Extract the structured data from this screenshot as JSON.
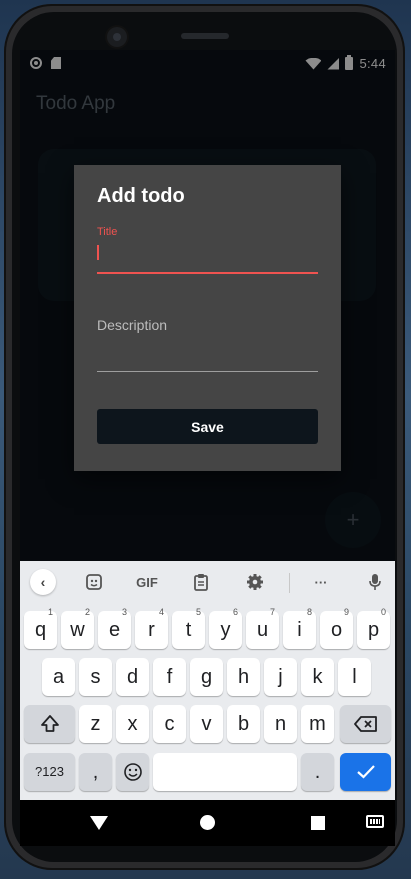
{
  "status_bar": {
    "time": "5:44"
  },
  "app": {
    "title": "Todo App",
    "fab_label": "+"
  },
  "dialog": {
    "title": "Add todo",
    "title_field_label": "Title",
    "title_field_value": "",
    "description_field_label": "Description",
    "description_field_value": "",
    "save_label": "Save"
  },
  "keyboard": {
    "toolbar": {
      "back": "‹",
      "gif": "GIF",
      "more": "···"
    },
    "row1": [
      {
        "key": "q",
        "hint": "1"
      },
      {
        "key": "w",
        "hint": "2"
      },
      {
        "key": "e",
        "hint": "3"
      },
      {
        "key": "r",
        "hint": "4"
      },
      {
        "key": "t",
        "hint": "5"
      },
      {
        "key": "y",
        "hint": "6"
      },
      {
        "key": "u",
        "hint": "7"
      },
      {
        "key": "i",
        "hint": "8"
      },
      {
        "key": "o",
        "hint": "9"
      },
      {
        "key": "p",
        "hint": "0"
      }
    ],
    "row2": [
      "a",
      "s",
      "d",
      "f",
      "g",
      "h",
      "j",
      "k",
      "l"
    ],
    "row3": [
      "z",
      "x",
      "c",
      "v",
      "b",
      "n",
      "m"
    ],
    "row4": {
      "symbols": "?123",
      "comma": ",",
      "period": "."
    },
    "icons": [
      "emoji-sticker-icon",
      "clipboard-icon",
      "settings-icon",
      "mic-icon",
      "shift-icon",
      "backspace-icon",
      "emoji-icon",
      "check-icon"
    ]
  },
  "colors": {
    "accent": "#ef5350",
    "enter_key": "#1a73e8",
    "dialog_bg": "#454545"
  }
}
